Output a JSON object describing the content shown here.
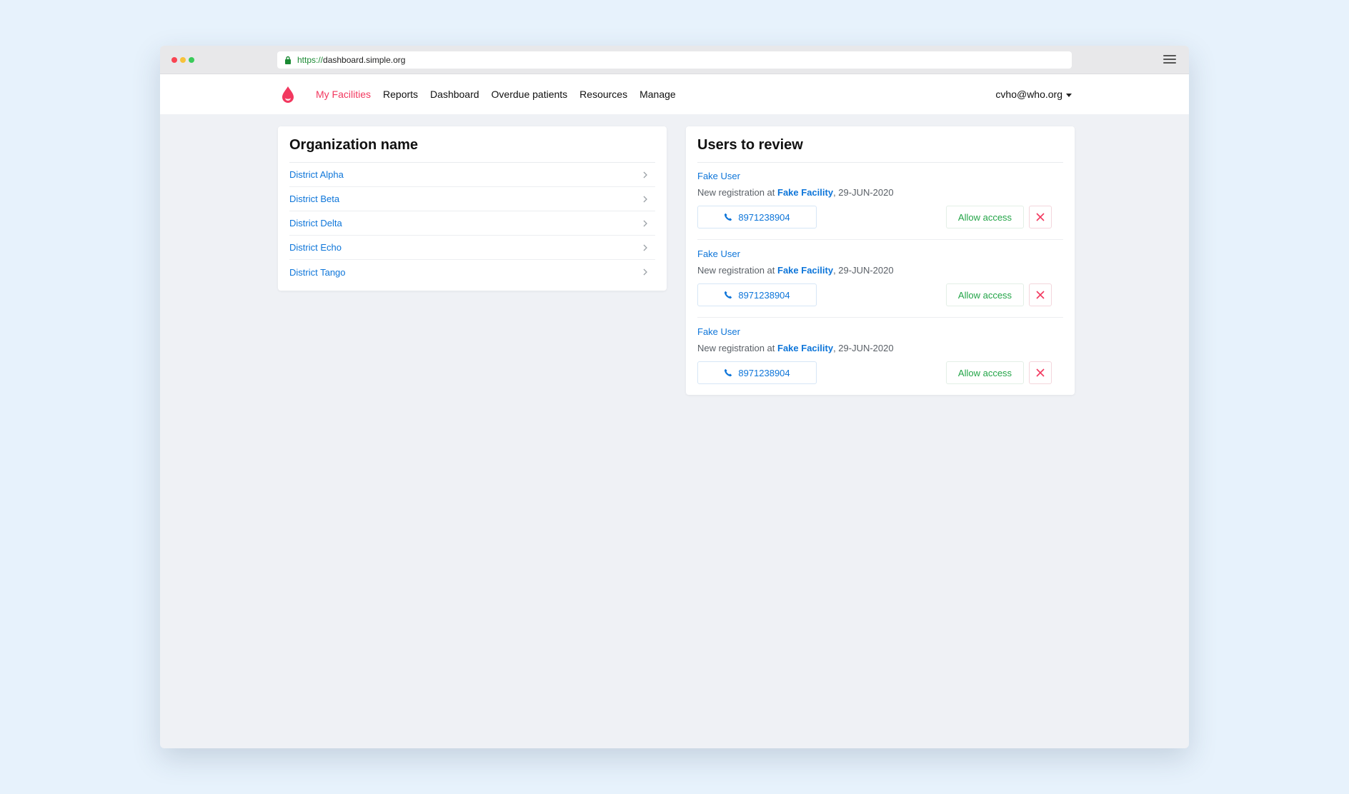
{
  "browser": {
    "url_scheme": "https://",
    "url_host": "dashboard.simple.org",
    "lock_icon": "lock-icon",
    "menu_icon": "hamburger-icon"
  },
  "nav": {
    "logo_icon": "blood-drop-icon",
    "items": [
      {
        "label": "My Facilities",
        "active": true
      },
      {
        "label": "Reports",
        "active": false
      },
      {
        "label": "Dashboard",
        "active": false
      },
      {
        "label": "Overdue patients",
        "active": false
      },
      {
        "label": "Resources",
        "active": false
      },
      {
        "label": "Manage",
        "active": false
      }
    ],
    "user": "cvho@who.org"
  },
  "organization": {
    "title": "Organization name",
    "districts": [
      {
        "name": "District Alpha"
      },
      {
        "name": "District Beta"
      },
      {
        "name": "District Delta"
      },
      {
        "name": "District Echo"
      },
      {
        "name": "District Tango"
      }
    ]
  },
  "review": {
    "title": "Users to review",
    "users": [
      {
        "name": "Fake User",
        "prefix": "New registration at",
        "facility": "Fake Facility",
        "date": ", 29-JUN-2020",
        "phone": "8971238904",
        "allow_label": "Allow access"
      },
      {
        "name": "Fake User",
        "prefix": "New registration at",
        "facility": "Fake Facility",
        "date": ", 29-JUN-2020",
        "phone": "8971238904",
        "allow_label": "Allow access"
      },
      {
        "name": "Fake User",
        "prefix": "New registration at",
        "facility": "Fake Facility",
        "date": ", 29-JUN-2020",
        "phone": "8971238904",
        "allow_label": "Allow access"
      }
    ]
  },
  "colors": {
    "brand": "#f2385f",
    "link": "#0d75d9",
    "success": "#22a447",
    "page_bg": "#eff1f5"
  }
}
